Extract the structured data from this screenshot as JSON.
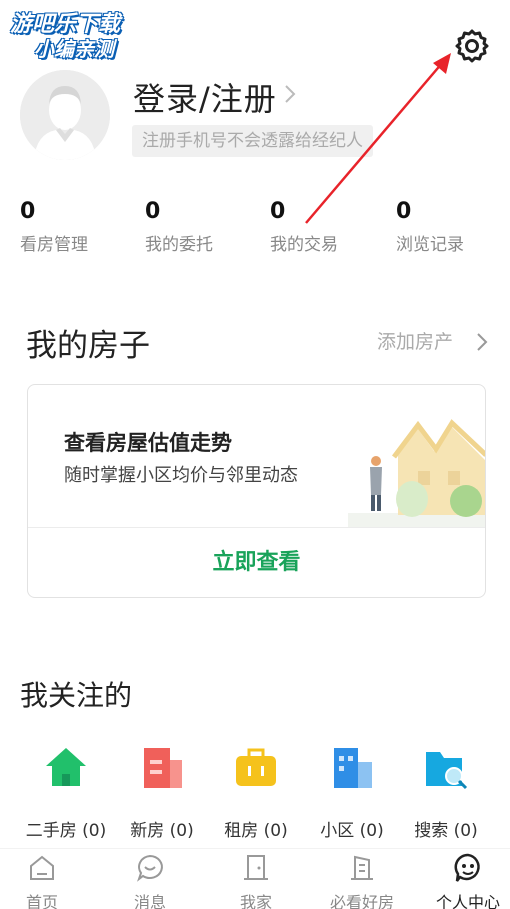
{
  "watermark": {
    "line1": "游吧乐下载",
    "line2": "小编亲测"
  },
  "header": {
    "login_title": "登录/注册",
    "login_hint": "注册手机号不会透露给经纪人"
  },
  "stats": [
    {
      "value": "0",
      "label": "看房管理"
    },
    {
      "value": "0",
      "label": "我的委托"
    },
    {
      "value": "0",
      "label": "我的交易"
    },
    {
      "value": "0",
      "label": "浏览记录"
    }
  ],
  "my_house": {
    "title": "我的房子",
    "add_label": "添加房产",
    "card_title": "查看房屋估值走势",
    "card_subtitle": "随时掌握小区均价与邻里动态",
    "cta": "立即查看"
  },
  "follow": {
    "title": "我关注的",
    "items": [
      {
        "label": "二手房 (0)",
        "icon": "green-house-icon",
        "color": "#21c06b"
      },
      {
        "label": "新房 (0)",
        "icon": "red-building-icon",
        "color": "#f0605a"
      },
      {
        "label": "租房 (0)",
        "icon": "yellow-suitcase-icon",
        "color": "#f5c21c"
      },
      {
        "label": "小区 (0)",
        "icon": "blue-apartment-icon",
        "color": "#2f8ee6"
      },
      {
        "label": "搜索 (0)",
        "icon": "cyan-folder-search-icon",
        "color": "#16a8e0"
      }
    ]
  },
  "tabbar": [
    {
      "label": "首页",
      "icon": "home-icon"
    },
    {
      "label": "消息",
      "icon": "chat-icon"
    },
    {
      "label": "我家",
      "icon": "door-icon"
    },
    {
      "label": "必看好房",
      "icon": "building-icon"
    },
    {
      "label": "个人中心",
      "icon": "profile-icon",
      "active": true
    }
  ],
  "colors": {
    "accent": "#19a35a",
    "annotation_arrow": "#e8232a"
  }
}
